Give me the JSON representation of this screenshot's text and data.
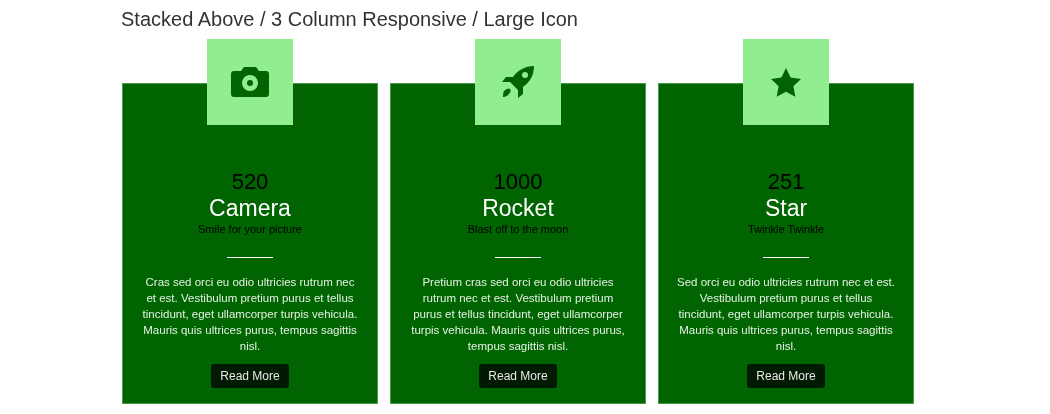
{
  "heading": "Stacked Above / 3 Column Responsive / Large Icon",
  "cards": [
    {
      "kind": "camera",
      "count": "520",
      "title": "Camera",
      "subtitle": "Smile for your picture",
      "body": "Cras sed orci eu odio ultricies rutrum nec et est. Vestibulum pretium purus et tellus tincidunt, eget ullamcorper turpis vehicula. Mauris quis ultrices purus, tempus sagittis nisl.",
      "button": "Read More"
    },
    {
      "kind": "rocket",
      "count": "1000",
      "title": "Rocket",
      "subtitle": "Blast off to the moon",
      "body": "Pretium cras sed orci eu odio ultricies rutrum nec et est. Vestibulum pretium purus et tellus tincidunt, eget ullamcorper turpis vehicula. Mauris quis ultrices purus, tempus sagittis nisl.",
      "button": "Read More"
    },
    {
      "kind": "star",
      "count": "251",
      "title": "Star",
      "subtitle": "Twinkle Twinkle",
      "body": "Sed orci eu odio ultricies rutrum nec et est. Vestibulum pretium purus et tellus tincidunt, eget ullamcorper turpis vehicula. Mauris quis ultrices purus, tempus sagittis nisl.",
      "button": "Read More"
    }
  ]
}
